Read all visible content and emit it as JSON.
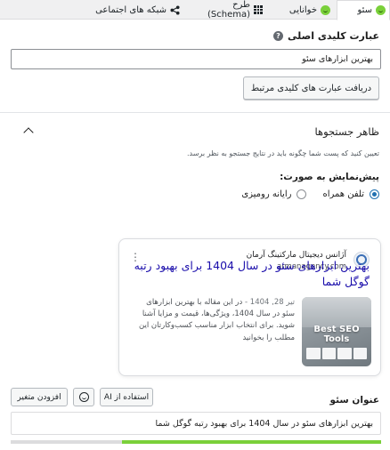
{
  "tabs": [
    {
      "label": "سئو",
      "icon": "smiley-icon"
    },
    {
      "label": "خوانایی",
      "icon": "smiley-icon"
    },
    {
      "label": "طرح (Schema)",
      "icon": "grid-icon"
    },
    {
      "label": "شبکه های اجتماعی",
      "icon": "share-icon"
    }
  ],
  "focus": {
    "title": "عبارت کلیدی اصلی",
    "value": "بهترین ابزارهای سئو",
    "related_button": "دریافت عبارت های کلیدی مرتبط"
  },
  "search_appearance": {
    "title": "ظاهر جستجوها",
    "description": "تعیین کنید که پست شما چگونه باید در نتایج جستجو به نظر برسد.",
    "preview_label": "پیش‌نمایش به صورت:",
    "mobile_label": "تلفن همراه",
    "desktop_label": "رایانه رومیزی",
    "selected": "mobile"
  },
  "preview": {
    "site_name": "آژانس دیجیتال مارکتینگ آرمان",
    "site_url": "armanagency.com",
    "title": "بهترین ابزارهای سئو در سال 1404 برای بهبود رتبه گوگل شما",
    "date": "تیر 28, 1404",
    "separator": "-",
    "snippet": "در این مقاله با بهترین ابزارهای سئو در سال 1404، ویژگی‌ها، قیمت و مزایا آشنا شوید. برای انتخاب ابزار مناسب کسب‌وکارتان این مطلب را بخوانید",
    "thumbnail_text": "Best SEO Tools"
  },
  "seo_title": {
    "label": "عنوان سئو",
    "ai_button": "استفاده از AI",
    "variable_button": "افزودن متغیر",
    "value": "بهترین ابزارهای سئو در سال 1404 برای بهبود رتبه گوگل شما",
    "progress": 0.7
  },
  "colors": {
    "accent_green": "#7ad03a",
    "link_blue": "#1a0dab",
    "radio_blue": "#2271b1"
  }
}
